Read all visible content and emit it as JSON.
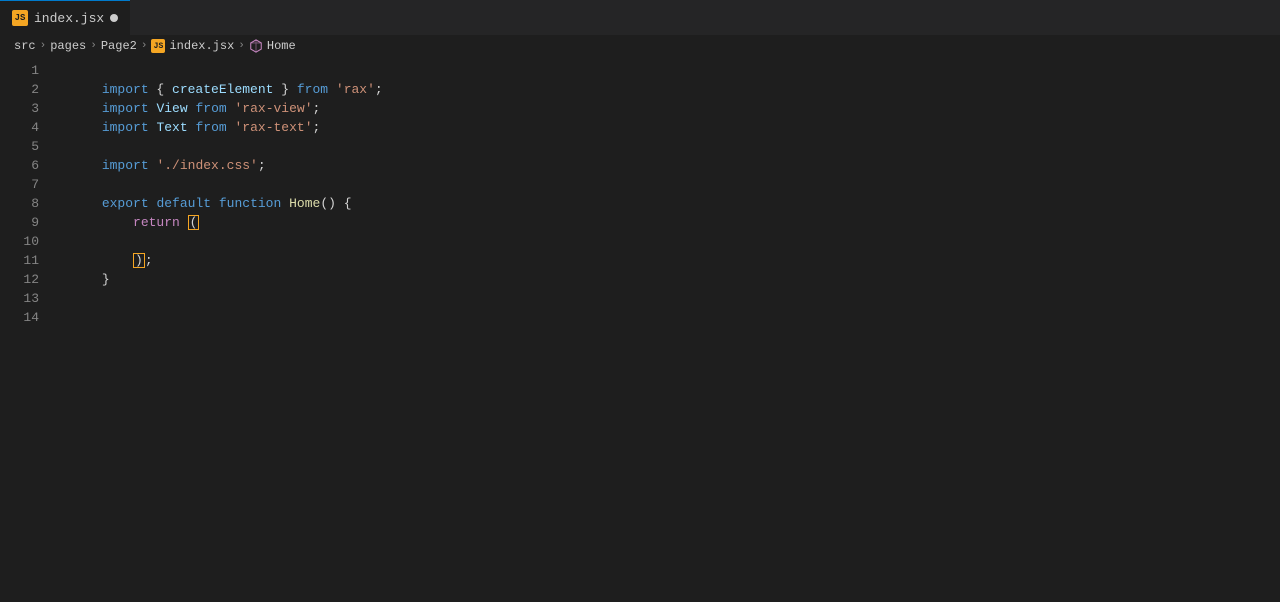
{
  "tab": {
    "icon": "JS",
    "filename": "index.jsx",
    "has_dot": true
  },
  "breadcrumb": {
    "items": [
      {
        "label": "src",
        "type": "text"
      },
      {
        "label": ">",
        "type": "sep"
      },
      {
        "label": "pages",
        "type": "text"
      },
      {
        "label": ">",
        "type": "sep"
      },
      {
        "label": "Page2",
        "type": "text"
      },
      {
        "label": ">",
        "type": "sep"
      },
      {
        "label": "JS",
        "type": "js-icon"
      },
      {
        "label": "index.jsx",
        "type": "text"
      },
      {
        "label": ">",
        "type": "sep"
      },
      {
        "label": "⬡",
        "type": "cube"
      },
      {
        "label": "Home",
        "type": "text"
      }
    ]
  },
  "lines": [
    {
      "number": "1",
      "tokens": [
        {
          "text": "import",
          "cls": "kw-import"
        },
        {
          "text": " { ",
          "cls": "punctuation"
        },
        {
          "text": "createElement",
          "cls": "identifier"
        },
        {
          "text": " } ",
          "cls": "punctuation"
        },
        {
          "text": "from",
          "cls": "kw-from"
        },
        {
          "text": " ",
          "cls": "punctuation"
        },
        {
          "text": "'rax'",
          "cls": "string"
        },
        {
          "text": ";",
          "cls": "punctuation"
        }
      ]
    },
    {
      "number": "2",
      "tokens": [
        {
          "text": "import",
          "cls": "kw-import"
        },
        {
          "text": " ",
          "cls": "punctuation"
        },
        {
          "text": "View",
          "cls": "identifier"
        },
        {
          "text": " ",
          "cls": "punctuation"
        },
        {
          "text": "from",
          "cls": "kw-from"
        },
        {
          "text": " ",
          "cls": "punctuation"
        },
        {
          "text": "'rax-view'",
          "cls": "string"
        },
        {
          "text": ";",
          "cls": "punctuation"
        }
      ]
    },
    {
      "number": "3",
      "tokens": [
        {
          "text": "import",
          "cls": "kw-import"
        },
        {
          "text": " ",
          "cls": "punctuation"
        },
        {
          "text": "Text",
          "cls": "identifier"
        },
        {
          "text": " ",
          "cls": "punctuation"
        },
        {
          "text": "from",
          "cls": "kw-from"
        },
        {
          "text": " ",
          "cls": "punctuation"
        },
        {
          "text": "'rax-text'",
          "cls": "string"
        },
        {
          "text": ";",
          "cls": "punctuation"
        }
      ]
    },
    {
      "number": "4",
      "tokens": []
    },
    {
      "number": "5",
      "tokens": [
        {
          "text": "import",
          "cls": "kw-import"
        },
        {
          "text": " ",
          "cls": "punctuation"
        },
        {
          "text": "'./index.css'",
          "cls": "string"
        },
        {
          "text": ";",
          "cls": "punctuation"
        }
      ]
    },
    {
      "number": "6",
      "tokens": []
    },
    {
      "number": "7",
      "tokens": [
        {
          "text": "export",
          "cls": "kw-export"
        },
        {
          "text": " ",
          "cls": "punctuation"
        },
        {
          "text": "default",
          "cls": "kw-default"
        },
        {
          "text": " ",
          "cls": "punctuation"
        },
        {
          "text": "function",
          "cls": "kw-function"
        },
        {
          "text": " ",
          "cls": "punctuation"
        },
        {
          "text": "Home",
          "cls": "fn-name"
        },
        {
          "text": "() {",
          "cls": "punctuation"
        }
      ]
    },
    {
      "number": "8",
      "tokens": [
        {
          "text": "    return",
          "cls": "kw-return"
        },
        {
          "text": " ",
          "cls": "punctuation"
        },
        {
          "text": "(",
          "cls": "cursor-open-paren"
        }
      ]
    },
    {
      "number": "9",
      "tokens": []
    },
    {
      "number": "10",
      "tokens": [
        {
          "text": "    ",
          "cls": "punctuation"
        },
        {
          "text": ")",
          "cls": "cursor-close-paren"
        },
        {
          "text": ";",
          "cls": "punctuation"
        }
      ]
    },
    {
      "number": "11",
      "tokens": [
        {
          "text": "}",
          "cls": "brace"
        }
      ]
    },
    {
      "number": "12",
      "tokens": []
    },
    {
      "number": "13",
      "tokens": []
    },
    {
      "number": "14",
      "tokens": []
    }
  ]
}
